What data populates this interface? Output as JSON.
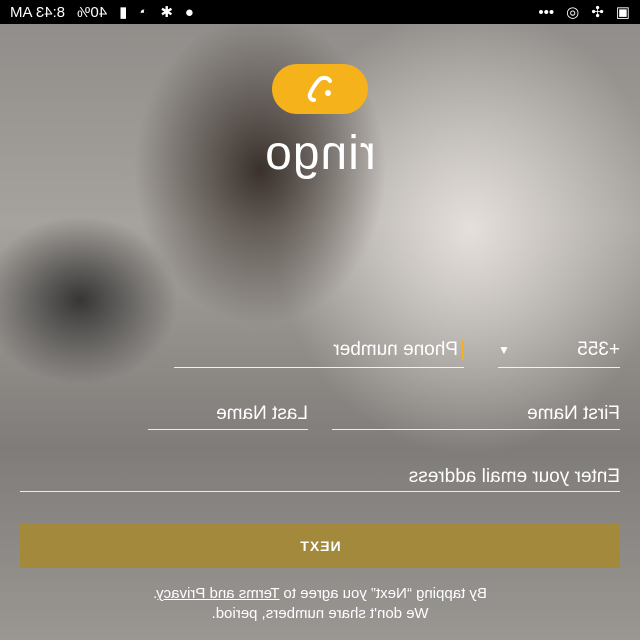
{
  "status_bar": {
    "time": "8:43 AM",
    "battery": "40%",
    "icons": [
      "wifi-icon",
      "bluetooth-icon",
      "location-icon",
      "more-icon",
      "sync-icon",
      "fan-icon",
      "image-icon"
    ]
  },
  "brand": {
    "name": "ringo",
    "logo_color": "#f5b21b"
  },
  "form": {
    "country_code": "+355",
    "phone_placeholder": "Phone number",
    "first_name_placeholder": "First Name",
    "last_name_placeholder": "Last Name",
    "email_placeholder": "Enter your email address"
  },
  "next_button": {
    "label": "NEXT",
    "color": "#a3893b"
  },
  "legal": {
    "line1_prefix": "By tapping “Next” you agree to",
    "link_label": "Terms and Privacy",
    "line1_suffix": ".",
    "line2": "We don't share numbers, period."
  }
}
